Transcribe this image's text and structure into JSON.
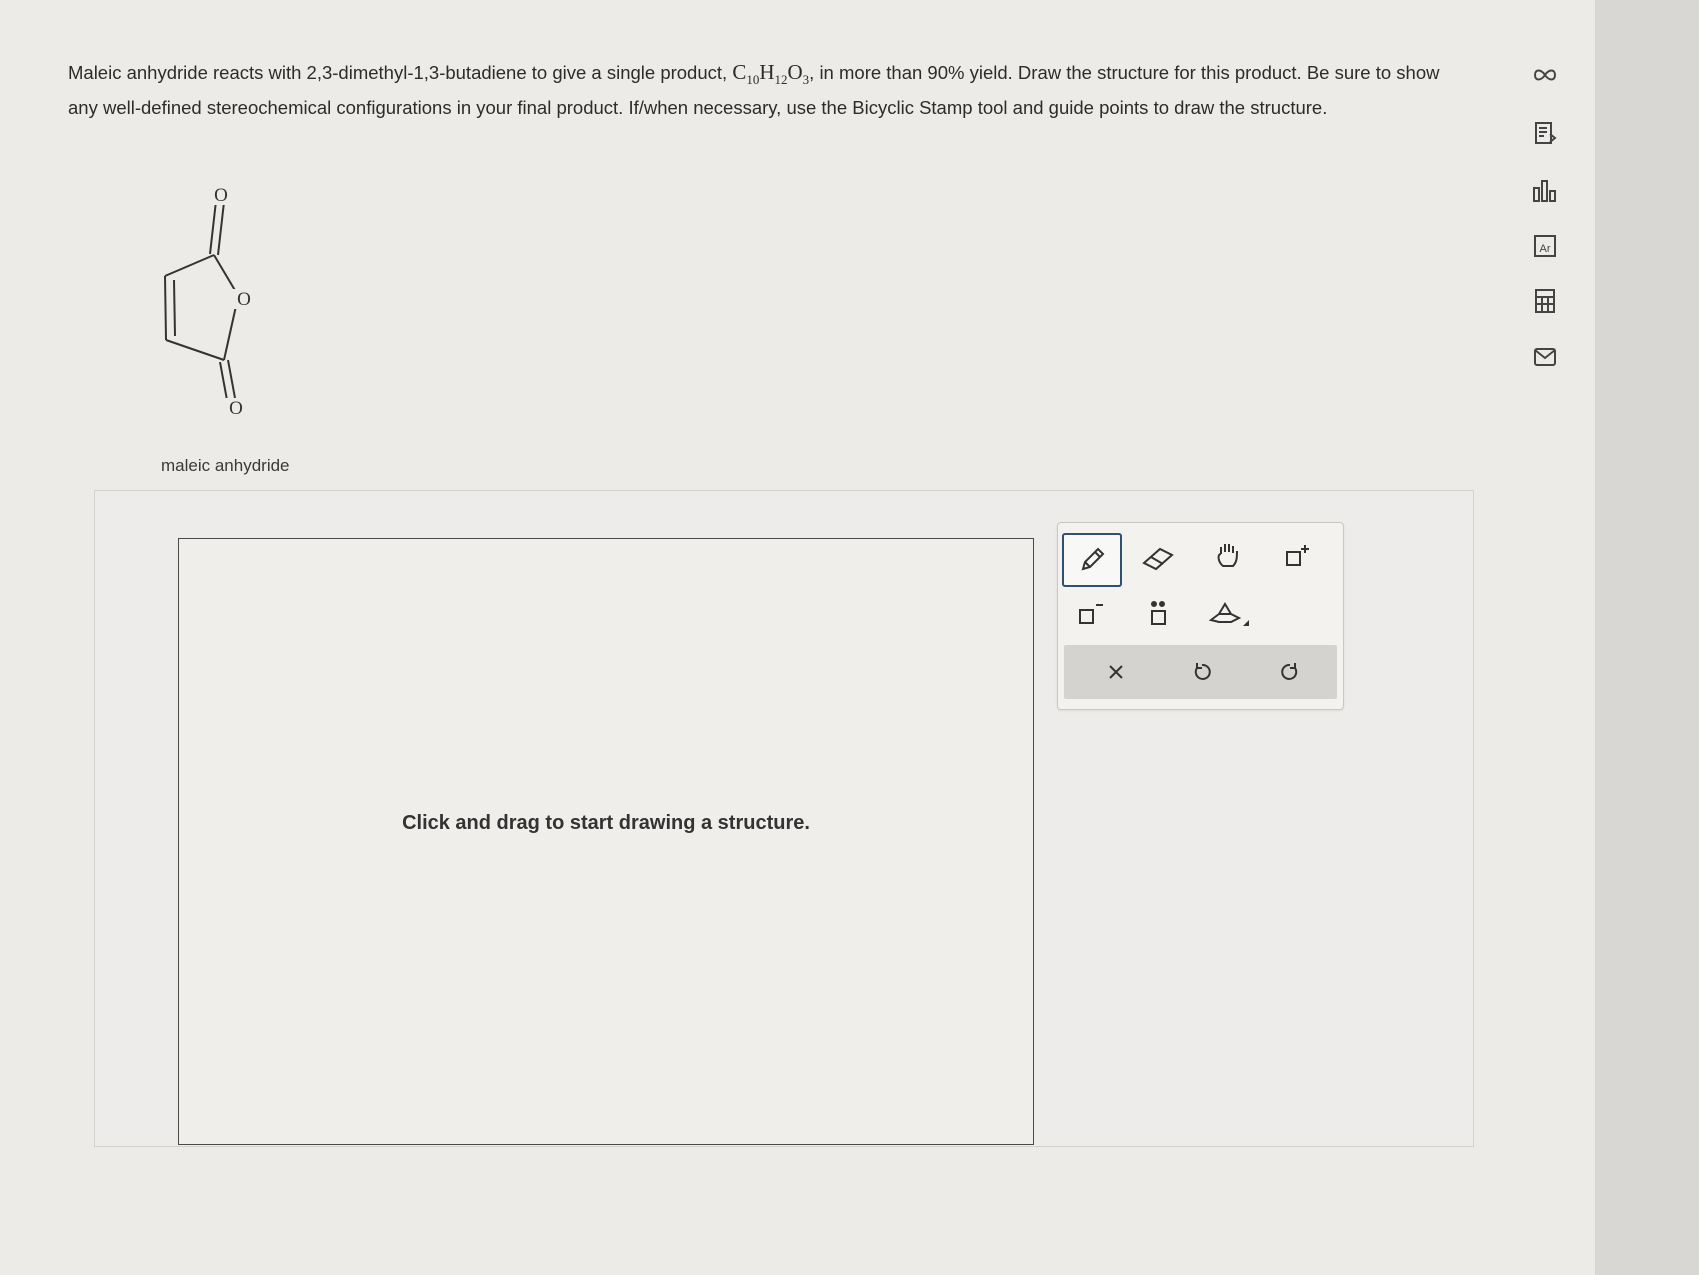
{
  "question": {
    "part1": "Maleic anhydride reacts with 2,3-dimethyl-1,3-butadiene to give a single product, ",
    "formula": {
      "c": "C",
      "c_sub": "10",
      "h": "H",
      "h_sub": "12",
      "o": "O",
      "o_sub": "3"
    },
    "part2": ", in more than 90% yield. Draw the structure for this product. Be sure to show any well-defined stereochemical configurations in your final product. If/when necessary, use the Bicyclic Stamp tool and guide points to draw the structure."
  },
  "molecule": {
    "atom_labels": {
      "o_top": "O",
      "o_ring": "O",
      "o_bottom": "O"
    },
    "caption": "maleic anhydride"
  },
  "canvas": {
    "hint": "Click and drag to start drawing a structure."
  },
  "toolbar": {
    "tools": [
      {
        "name": "pencil-icon",
        "selected": true
      },
      {
        "name": "eraser-icon",
        "selected": false
      },
      {
        "name": "hand-icon",
        "selected": false
      },
      {
        "name": "positive-charge-icon",
        "selected": false
      },
      {
        "name": "negative-charge-icon",
        "selected": false
      },
      {
        "name": "lone-pair-icon",
        "selected": false
      },
      {
        "name": "bicyclic-stamp-icon",
        "selected": false
      }
    ],
    "actions": [
      "clear-icon",
      "undo-icon",
      "redo-icon"
    ],
    "accent_color": "#2f4f73"
  },
  "sidebar": {
    "icons": [
      "infinity-icon",
      "reading-icon",
      "chart-icon",
      "periodic-table-icon",
      "calculator-icon",
      "mail-icon"
    ]
  }
}
